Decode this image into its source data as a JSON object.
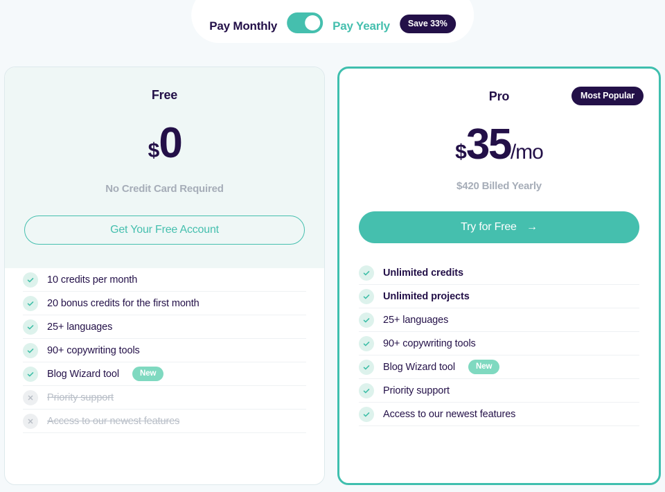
{
  "billing_toggle": {
    "monthly_label": "Pay Monthly",
    "yearly_label": "Pay Yearly",
    "save_badge": "Save 33%",
    "switch_state": "yearly",
    "switch_icon": "toggle-switch-icon"
  },
  "colors": {
    "page_background": "#f5f9fb",
    "accent_teal": "#45bfae",
    "dark_indigo": "#231048",
    "muted_grey": "#a6adb8",
    "mint_tint": "#eff7f6",
    "check_circle": "#ddf2ec",
    "new_badge": "#7fd9c0"
  },
  "plans": [
    {
      "name": "Free",
      "currency": "$",
      "amount": "0",
      "period": "",
      "sub_note": "No Credit Card Required",
      "cta_label": "Get Your Free Account",
      "cta_style": "outline",
      "cta_arrow": "",
      "badge": "",
      "features": [
        {
          "text": "10 credits per month",
          "included": true,
          "bold": false,
          "badge": ""
        },
        {
          "text": "20 bonus credits for the first month",
          "included": true,
          "bold": false,
          "badge": ""
        },
        {
          "text": "25+ languages",
          "included": true,
          "bold": false,
          "badge": ""
        },
        {
          "text": "90+ copywriting tools",
          "included": true,
          "bold": false,
          "badge": ""
        },
        {
          "text": "Blog Wizard tool",
          "included": true,
          "bold": false,
          "badge": "New"
        },
        {
          "text": "Priority support",
          "included": false,
          "bold": false,
          "badge": ""
        },
        {
          "text": "Access to our newest features",
          "included": false,
          "bold": false,
          "badge": ""
        }
      ]
    },
    {
      "name": "Pro",
      "currency": "$",
      "amount": "35",
      "period": "/mo",
      "sub_note": "$420 Billed Yearly",
      "cta_label": "Try for Free",
      "cta_style": "solid",
      "cta_arrow": "→",
      "badge": "Most Popular",
      "features": [
        {
          "text": "Unlimited credits",
          "included": true,
          "bold": true,
          "badge": ""
        },
        {
          "text": "Unlimited projects",
          "included": true,
          "bold": true,
          "badge": ""
        },
        {
          "text": "25+ languages",
          "included": true,
          "bold": false,
          "badge": ""
        },
        {
          "text": "90+ copywriting tools",
          "included": true,
          "bold": false,
          "badge": ""
        },
        {
          "text": "Blog Wizard tool",
          "included": true,
          "bold": false,
          "badge": "New"
        },
        {
          "text": "Priority support",
          "included": true,
          "bold": false,
          "badge": ""
        },
        {
          "text": "Access to our newest features",
          "included": true,
          "bold": false,
          "badge": ""
        }
      ]
    }
  ]
}
